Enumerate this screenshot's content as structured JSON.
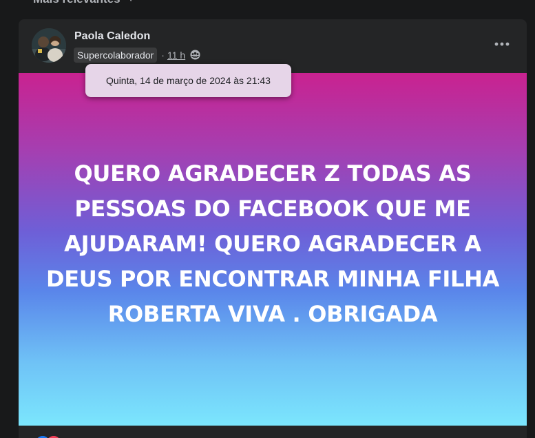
{
  "sort": {
    "label": "Mais relevantes",
    "icon": "chevron-down-icon"
  },
  "post": {
    "author": "Paola Caledon",
    "badge": "Supercolaborador",
    "separator": "·",
    "time": "11 h",
    "audience_icon": "group-icon",
    "more_icon": "more-dots-icon",
    "tooltip_date": "Quinta, 14 de março de 2024 às 21:43",
    "text": "QUERO AGRADECER Z TODAS AS PESSOAS DO FACEBOOK QUE ME AJUDARAM! QUERO AGRADECER A DEUS POR ENCONTRAR MINHA FILHA ROBERTA VIVA . OBRIGADA",
    "background_colors": [
      "#c92290",
      "#6e5fd7",
      "#7be6fd"
    ]
  },
  "reactions": {
    "icons": [
      "like-icon",
      "love-icon"
    ]
  },
  "colors": {
    "page_bg": "#18191a",
    "card_bg": "#242526",
    "primary_text": "#e4e6eb",
    "secondary_text": "#b0b3b8"
  }
}
